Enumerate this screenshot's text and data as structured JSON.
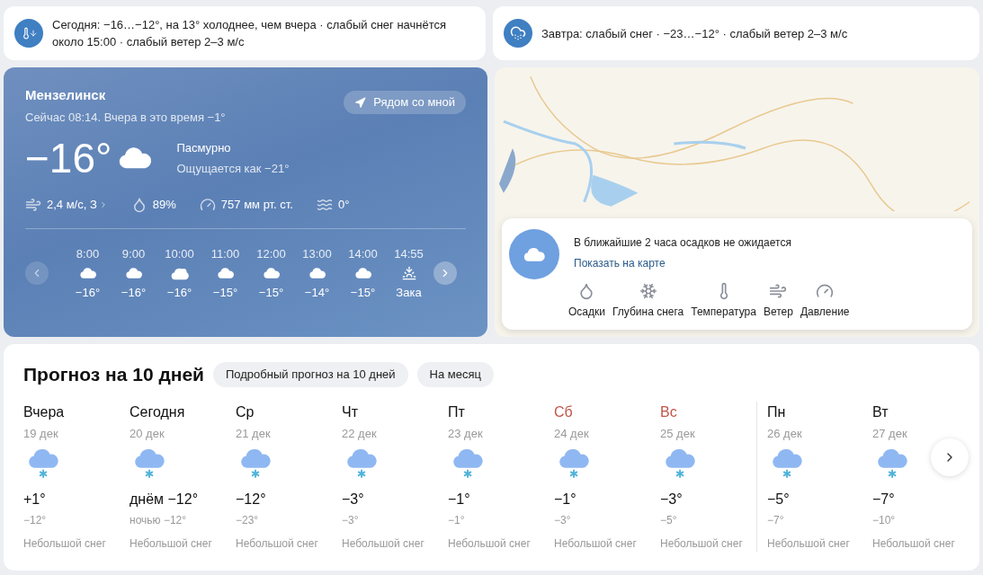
{
  "alerts": [
    {
      "kind": "cold",
      "text": "Сегодня: −16…−12°, на 13° холоднее, чем вчера · слабый снег начнётся около 15:00 · слабый ветер 2–3 м/с"
    },
    {
      "kind": "snow",
      "text": "Завтра: слабый снег · −23…−12° · слабый ветер 2–3 м/с"
    }
  ],
  "current": {
    "city": "Мензелинск",
    "subtitle": "Сейчас 08:14. Вчера в это время −1°",
    "nearby_button": "Рядом со мной",
    "temperature": "−16°",
    "condition": "Пасмурно",
    "feels_like": "Ощущается как −21°",
    "stats": [
      {
        "kind": "wind",
        "text": "2,4 м/с, З"
      },
      {
        "kind": "humidity",
        "text": "89%"
      },
      {
        "kind": "pressure",
        "text": "757 мм рт. ст."
      },
      {
        "kind": "water",
        "text": "0°"
      }
    ],
    "hourly": [
      {
        "time": "8:00",
        "kind": "cloudy",
        "temp": "−16°"
      },
      {
        "time": "9:00",
        "kind": "cloudy",
        "temp": "−16°"
      },
      {
        "time": "10:00",
        "kind": "partly_sunny",
        "temp": "−16°"
      },
      {
        "time": "11:00",
        "kind": "cloudy",
        "temp": "−15°"
      },
      {
        "time": "12:00",
        "kind": "cloudy",
        "temp": "−15°"
      },
      {
        "time": "13:00",
        "kind": "cloudy",
        "temp": "−14°"
      },
      {
        "time": "14:00",
        "kind": "cloudy",
        "temp": "−15°"
      },
      {
        "time": "14:55",
        "kind": "sunset",
        "temp": "Зака"
      }
    ]
  },
  "nowcast": {
    "text": "В ближайшие 2 часа осадков не ожидается",
    "link": "Показать на карте",
    "layers": [
      {
        "kind": "precipitation",
        "label": "Осадки"
      },
      {
        "kind": "snow_depth",
        "label": "Глубина снега"
      },
      {
        "kind": "temperature",
        "label": "Температура"
      },
      {
        "kind": "wind",
        "label": "Ветер"
      },
      {
        "kind": "pressure",
        "label": "Давление"
      }
    ]
  },
  "forecast": {
    "title": "Прогноз на 10 дней",
    "buttons": [
      "Подробный прогноз на 10 дней",
      "На месяц"
    ],
    "days": [
      {
        "day": "Вчера",
        "date": "19 дек",
        "weekend": false,
        "week_start": false,
        "high": "+1°",
        "low": "−12°",
        "condition": "Небольшой снег"
      },
      {
        "day": "Сегодня",
        "date": "20 дек",
        "weekend": false,
        "week_start": false,
        "high": "днём −12°",
        "low": "ночью −12°",
        "condition": "Небольшой снег"
      },
      {
        "day": "Ср",
        "date": "21 дек",
        "weekend": false,
        "week_start": false,
        "high": "−12°",
        "low": "−23°",
        "condition": "Небольшой снег"
      },
      {
        "day": "Чт",
        "date": "22 дек",
        "weekend": false,
        "week_start": false,
        "high": "−3°",
        "low": "−3°",
        "condition": "Небольшой снег"
      },
      {
        "day": "Пт",
        "date": "23 дек",
        "weekend": false,
        "week_start": false,
        "high": "−1°",
        "low": "−1°",
        "condition": "Небольшой снег"
      },
      {
        "day": "Сб",
        "date": "24 дек",
        "weekend": true,
        "week_start": false,
        "high": "−1°",
        "low": "−3°",
        "condition": "Небольшой снег"
      },
      {
        "day": "Вс",
        "date": "25 дек",
        "weekend": true,
        "week_start": false,
        "high": "−3°",
        "low": "−5°",
        "condition": "Небольшой снег"
      },
      {
        "day": "Пн",
        "date": "26 дек",
        "weekend": false,
        "week_start": true,
        "high": "−5°",
        "low": "−7°",
        "condition": "Небольшой снег"
      },
      {
        "day": "Вт",
        "date": "27 дек",
        "weekend": false,
        "week_start": false,
        "high": "−7°",
        "low": "−10°",
        "condition": "Небольшой снег"
      }
    ]
  }
}
